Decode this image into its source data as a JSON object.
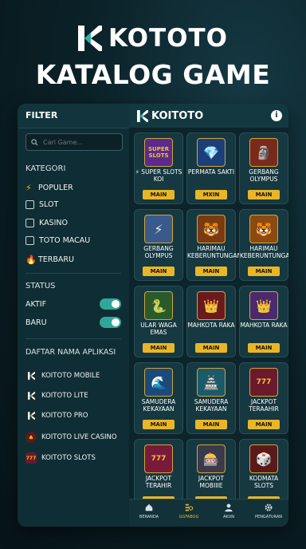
{
  "hero": {
    "brand": "KOTOTO",
    "title": "KATALOG GAME"
  },
  "filter": {
    "title": "FILTER",
    "search_placeholder": "Cari Game...",
    "kategori_label": "KATEGORI",
    "kategori": [
      {
        "icon": "lightning-icon",
        "label": "POPULER"
      },
      {
        "icon": "checkbox-icon",
        "label": "SLOT"
      },
      {
        "icon": "checkbox-icon",
        "label": "KASINO"
      },
      {
        "icon": "checkbox-icon",
        "label": "TOTO MACAU"
      },
      {
        "icon": "fire-icon",
        "label": "TERBARU"
      }
    ],
    "status_label": "STATUS",
    "status": [
      {
        "label": "AKTIF",
        "on": true
      },
      {
        "label": "BARU",
        "on": true
      }
    ],
    "apps_label": "DAFTAR NAMA APLIKASI",
    "apps": [
      {
        "label": "KOITOTO MOBILE",
        "icon": "k-logo-icon"
      },
      {
        "label": "KOITOTO LITE",
        "icon": "k-logo-icon"
      },
      {
        "label": "KOITOTO PRO",
        "icon": "k-logo-icon"
      },
      {
        "label": "KOITOTO LIVE CASINO",
        "icon": "casino-chip-icon"
      },
      {
        "label": "KOITOTO SLOTS",
        "icon": "slot-machine-icon"
      }
    ]
  },
  "games_panel": {
    "brand": "KOITOTO",
    "button_label": "MAIN",
    "cards": [
      {
        "name": "⚡ SUPER SLOTS KOI",
        "button": "MAIN",
        "thumb": "SUPER SLOTS",
        "color": "#5b2a8c"
      },
      {
        "name": "PERMATA SAKTI",
        "button": "MXIN",
        "thumb": "💎",
        "color": "#1c3f7a"
      },
      {
        "name": "GERBANG OLYMPUS",
        "button": "MAIN",
        "thumb": "🗿",
        "color": "#7a2a1a"
      },
      {
        "name": "GERBANG OLYMPUS",
        "button": "MAIN",
        "thumb": "⚡",
        "color": "#3a5a8c"
      },
      {
        "name": "HARIMAU KEBERUNTUNGAN",
        "button": "MAIN",
        "thumb": "🐯",
        "color": "#7a3a12"
      },
      {
        "name": "HARIMAU KEBERUNTUNGAN",
        "button": "MAIN",
        "thumb": "🐯",
        "color": "#8a4a12"
      },
      {
        "name": "ULAR WAGA EMAS",
        "button": "MAIN",
        "thumb": "🐍",
        "color": "#2a5a2a"
      },
      {
        "name": "MAHKOTA RAKA",
        "button": "MAIN",
        "thumb": "👑",
        "color": "#6a1a1a"
      },
      {
        "name": "MAHKOTA RAKA",
        "button": "MAIN",
        "thumb": "👑",
        "color": "#4a2a6a"
      },
      {
        "name": "SAMUDERA KEKAYAAN",
        "button": "MAIN",
        "thumb": "🌊",
        "color": "#1a4a7a"
      },
      {
        "name": "SAMUDERA KEKAYAAN",
        "button": "MAIN",
        "thumb": "🏯",
        "color": "#1a5a6a"
      },
      {
        "name": "JACKPOT TERAAHIR",
        "button": "MAIN",
        "thumb": "777",
        "color": "#6a1a2a"
      },
      {
        "name": "JACKPOT TERAHIR",
        "button": "MAIN",
        "thumb": "777",
        "color": "#7a1a3a"
      },
      {
        "name": "JACKPOT MOBIIIE",
        "button": "MAIN",
        "thumb": "🎰",
        "color": "#3a3a4a"
      },
      {
        "name": "KODMATA SLOTS",
        "button": "MAIN",
        "thumb": "🎲",
        "color": "#5a1a1a"
      }
    ]
  },
  "bottom_nav": [
    {
      "label": "BERANDA",
      "icon": "home-icon",
      "active": false
    },
    {
      "label": "GGFABOG",
      "icon": "catalog-icon",
      "active": true
    },
    {
      "label": "AKUN",
      "icon": "user-icon",
      "active": false
    },
    {
      "label": "PENGATURAN",
      "icon": "gear-icon",
      "active": false
    }
  ]
}
